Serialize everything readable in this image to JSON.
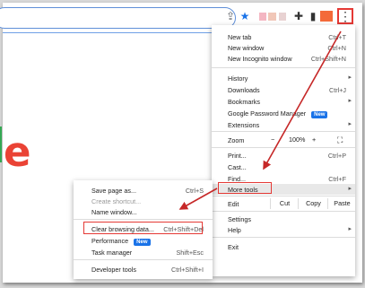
{
  "colors": {
    "accent": "#1a73e8",
    "annotation": "#e53935",
    "letter": "#ea4335"
  },
  "page": {
    "letter": "e"
  },
  "toolbar": {
    "icons": [
      "share-icon",
      "star-icon",
      "extensions-puzzle-icon",
      "side-panel-icon",
      "kebab-menu-icon"
    ],
    "menu_glyph": "⋮",
    "star_glyph": "★",
    "share_glyph": "⇪",
    "puzzle_glyph": "✚",
    "panel_glyph": "▮"
  },
  "menu": {
    "new_tab": {
      "label": "New tab",
      "shortcut": "Ctrl+T"
    },
    "new_window": {
      "label": "New window",
      "shortcut": "Ctrl+N"
    },
    "new_incognito": {
      "label": "New Incognito window",
      "shortcut": "Ctrl+Shift+N"
    },
    "history": {
      "label": "History"
    },
    "downloads": {
      "label": "Downloads",
      "shortcut": "Ctrl+J"
    },
    "bookmarks": {
      "label": "Bookmarks"
    },
    "password_manager": {
      "label": "Google Password Manager",
      "badge": "New"
    },
    "extensions": {
      "label": "Extensions"
    },
    "zoom": {
      "label": "Zoom",
      "value": "100%",
      "minus": "−",
      "plus": "+",
      "fullscreen": "⛶"
    },
    "print": {
      "label": "Print...",
      "shortcut": "Ctrl+P"
    },
    "cast": {
      "label": "Cast..."
    },
    "find": {
      "label": "Find...",
      "shortcut": "Ctrl+F"
    },
    "more_tools": {
      "label": "More tools"
    },
    "edit": {
      "label": "Edit",
      "cut": "Cut",
      "copy": "Copy",
      "paste": "Paste"
    },
    "settings": {
      "label": "Settings"
    },
    "help": {
      "label": "Help"
    },
    "exit": {
      "label": "Exit"
    },
    "arrow": "▸"
  },
  "submenu": {
    "save_page": {
      "label": "Save page as...",
      "shortcut": "Ctrl+S"
    },
    "create_shortcut": {
      "label": "Create shortcut..."
    },
    "name_window": {
      "label": "Name window..."
    },
    "clear_browsing": {
      "label": "Clear browsing data...",
      "shortcut": "Ctrl+Shift+Del"
    },
    "performance": {
      "label": "Performance",
      "badge": "New"
    },
    "task_manager": {
      "label": "Task manager",
      "shortcut": "Shift+Esc"
    },
    "developer_tools": {
      "label": "Developer tools",
      "shortcut": "Ctrl+Shift+I"
    }
  }
}
